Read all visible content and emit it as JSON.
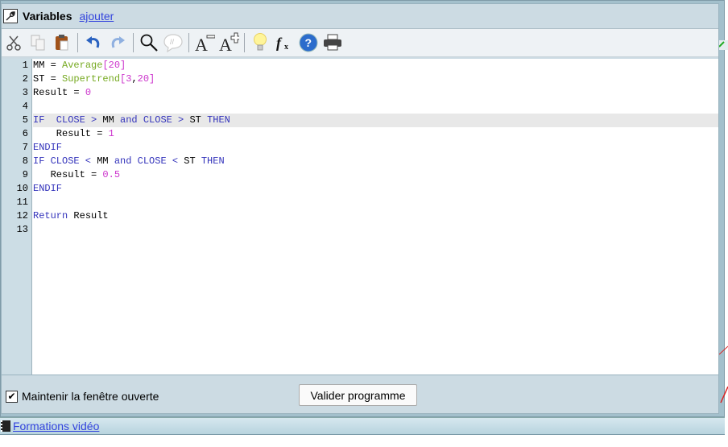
{
  "window": {
    "title": "Variables",
    "add_link": "ajouter"
  },
  "toolbar": {
    "icons": [
      "scissors-icon",
      "copy-icon",
      "paste-icon",
      "undo-icon",
      "redo-icon",
      "search-icon",
      "comment-icon",
      "font-decrease-icon",
      "font-increase-icon",
      "lightbulb-icon",
      "function-icon",
      "help-icon",
      "print-icon"
    ]
  },
  "editor": {
    "highlighted_line": 5,
    "lines": [
      {
        "n": "1",
        "tokens": [
          {
            "t": "MM = ",
            "c": "tx"
          },
          {
            "t": "Average",
            "c": "fn"
          },
          {
            "t": "[",
            "c": "num"
          },
          {
            "t": "20",
            "c": "num"
          },
          {
            "t": "]",
            "c": "num"
          }
        ]
      },
      {
        "n": "2",
        "tokens": [
          {
            "t": "ST = ",
            "c": "tx"
          },
          {
            "t": "Supertrend",
            "c": "fn"
          },
          {
            "t": "[",
            "c": "num"
          },
          {
            "t": "3",
            "c": "num"
          },
          {
            "t": ",",
            "c": "tx"
          },
          {
            "t": "20",
            "c": "num"
          },
          {
            "t": "]",
            "c": "num"
          }
        ]
      },
      {
        "n": "3",
        "tokens": [
          {
            "t": "Result = ",
            "c": "tx"
          },
          {
            "t": "0",
            "c": "num"
          }
        ]
      },
      {
        "n": "4",
        "tokens": []
      },
      {
        "n": "5",
        "tokens": [
          {
            "t": "IF  CLOSE > ",
            "c": "kw"
          },
          {
            "t": "MM ",
            "c": "tx"
          },
          {
            "t": "and CLOSE > ",
            "c": "kw"
          },
          {
            "t": "ST ",
            "c": "tx"
          },
          {
            "t": "THEN",
            "c": "kw"
          }
        ]
      },
      {
        "n": "6",
        "tokens": [
          {
            "t": "    Result = ",
            "c": "tx"
          },
          {
            "t": "1",
            "c": "num"
          }
        ]
      },
      {
        "n": "7",
        "tokens": [
          {
            "t": "ENDIF",
            "c": "kw"
          }
        ]
      },
      {
        "n": "8",
        "tokens": [
          {
            "t": "IF CLOSE < ",
            "c": "kw"
          },
          {
            "t": "MM ",
            "c": "tx"
          },
          {
            "t": "and CLOSE < ",
            "c": "kw"
          },
          {
            "t": "ST ",
            "c": "tx"
          },
          {
            "t": "THEN",
            "c": "kw"
          }
        ]
      },
      {
        "n": "9",
        "tokens": [
          {
            "t": "   Result = ",
            "c": "tx"
          },
          {
            "t": "0.5",
            "c": "num"
          }
        ]
      },
      {
        "n": "10",
        "tokens": [
          {
            "t": "ENDIF",
            "c": "kw"
          }
        ]
      },
      {
        "n": "11",
        "tokens": []
      },
      {
        "n": "12",
        "tokens": [
          {
            "t": "Return ",
            "c": "kw"
          },
          {
            "t": "Result",
            "c": "tx"
          }
        ]
      },
      {
        "n": "13",
        "tokens": []
      }
    ]
  },
  "footer": {
    "keep_open_label": "Maintenir la fenêtre ouverte",
    "keep_open_checked": true,
    "validate_label": "Valider programme"
  },
  "bottombar": {
    "link": "Formations vidéo"
  },
  "colors": {
    "keyword": "#3333bb",
    "function": "#77aa22",
    "number": "#cc33cc",
    "link": "#3344dd"
  }
}
